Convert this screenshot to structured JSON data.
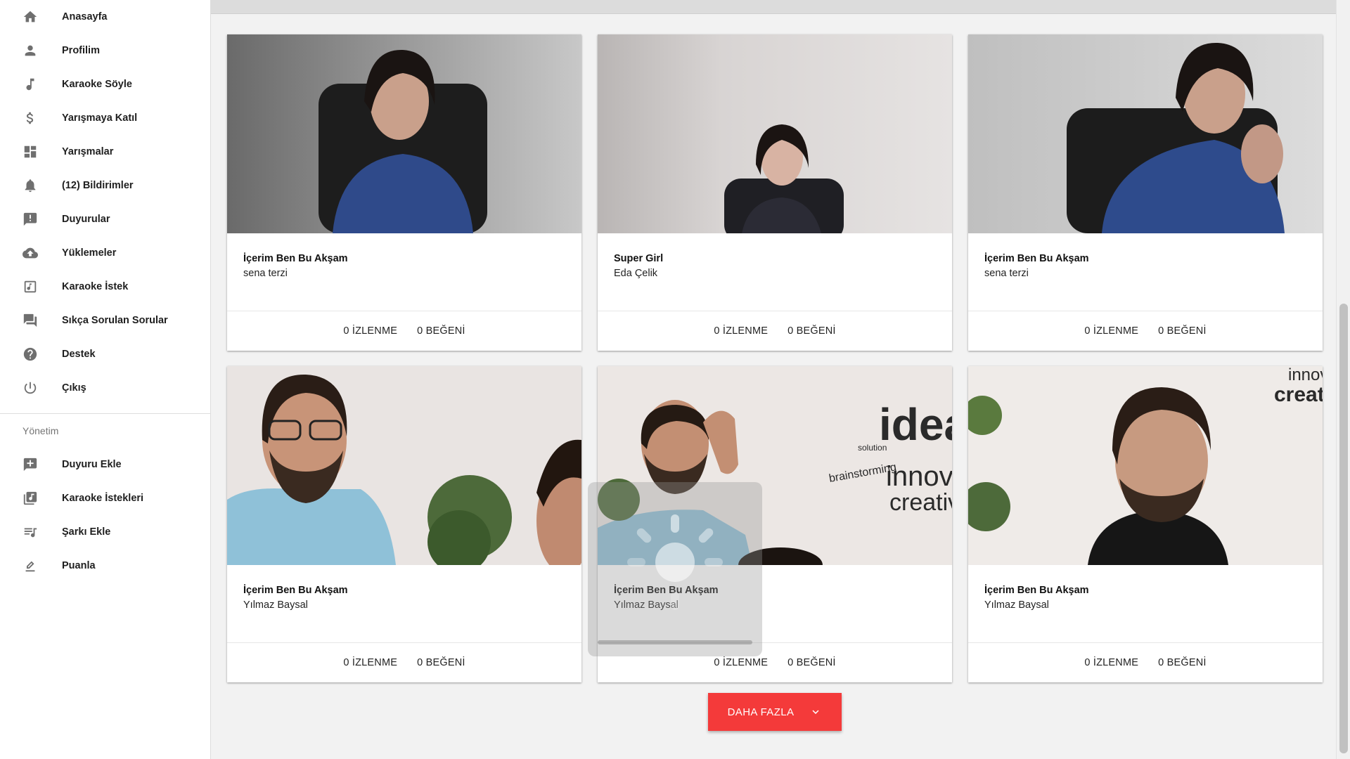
{
  "sidebar": {
    "items": [
      {
        "label": "Anasayfa",
        "icon": "home-icon"
      },
      {
        "label": "Profilim",
        "icon": "person-icon"
      },
      {
        "label": "Karaoke Söyle",
        "icon": "music-note-icon"
      },
      {
        "label": "Yarışmaya Katıl",
        "icon": "dollar-icon"
      },
      {
        "label": "Yarışmalar",
        "icon": "dashboard-icon"
      },
      {
        "label": "(12) Bildirimler",
        "icon": "bell-icon"
      },
      {
        "label": "Duyurular",
        "icon": "announcement-icon"
      },
      {
        "label": "Yüklemeler",
        "icon": "cloud-upload-icon"
      },
      {
        "label": "Karaoke İstek",
        "icon": "music-box-icon"
      },
      {
        "label": "Sıkça Sorulan Sorular",
        "icon": "forum-icon"
      },
      {
        "label": "Destek",
        "icon": "help-icon"
      },
      {
        "label": "Çıkış",
        "icon": "power-icon"
      }
    ],
    "admin_title": "Yönetim",
    "admin_items": [
      {
        "label": "Duyuru Ekle",
        "icon": "add-box-icon"
      },
      {
        "label": "Karaoke İstekleri",
        "icon": "library-music-icon"
      },
      {
        "label": "Şarkı Ekle",
        "icon": "playlist-add-icon"
      },
      {
        "label": "Puanla",
        "icon": "rate-icon"
      }
    ]
  },
  "cards": [
    {
      "title": "İçerim Ben Bu Akşam",
      "artist": "sena terzi",
      "views": "0 İZLENME",
      "likes": "0 BEĞENİ"
    },
    {
      "title": "Super Girl",
      "artist": "Eda Çelik",
      "views": "0 İZLENME",
      "likes": "0 BEĞENİ"
    },
    {
      "title": "İçerim Ben Bu Akşam",
      "artist": "sena terzi",
      "views": "0 İZLENME",
      "likes": "0 BEĞENİ"
    },
    {
      "title": "İçerim Ben Bu Akşam",
      "artist": "Yılmaz Baysal",
      "views": "0 İZLENME",
      "likes": "0 BEĞENİ"
    },
    {
      "title": "İçerim Ben Bu Akşam",
      "artist": "Yılmaz Baysal",
      "views": "0 İZLENME",
      "likes": "0 BEĞENİ"
    },
    {
      "title": "İçerim Ben Bu Akşam",
      "artist": "Yılmaz Baysal",
      "views": "0 İZLENME",
      "likes": "0 BEĞENİ"
    }
  ],
  "more_button": {
    "label": "DAHA FAZLA",
    "icon": "chevron-down-icon"
  },
  "colors": {
    "accent": "#f43a3a",
    "sidebar_bg": "#ffffff",
    "page_bg": "#f2f2f2"
  }
}
